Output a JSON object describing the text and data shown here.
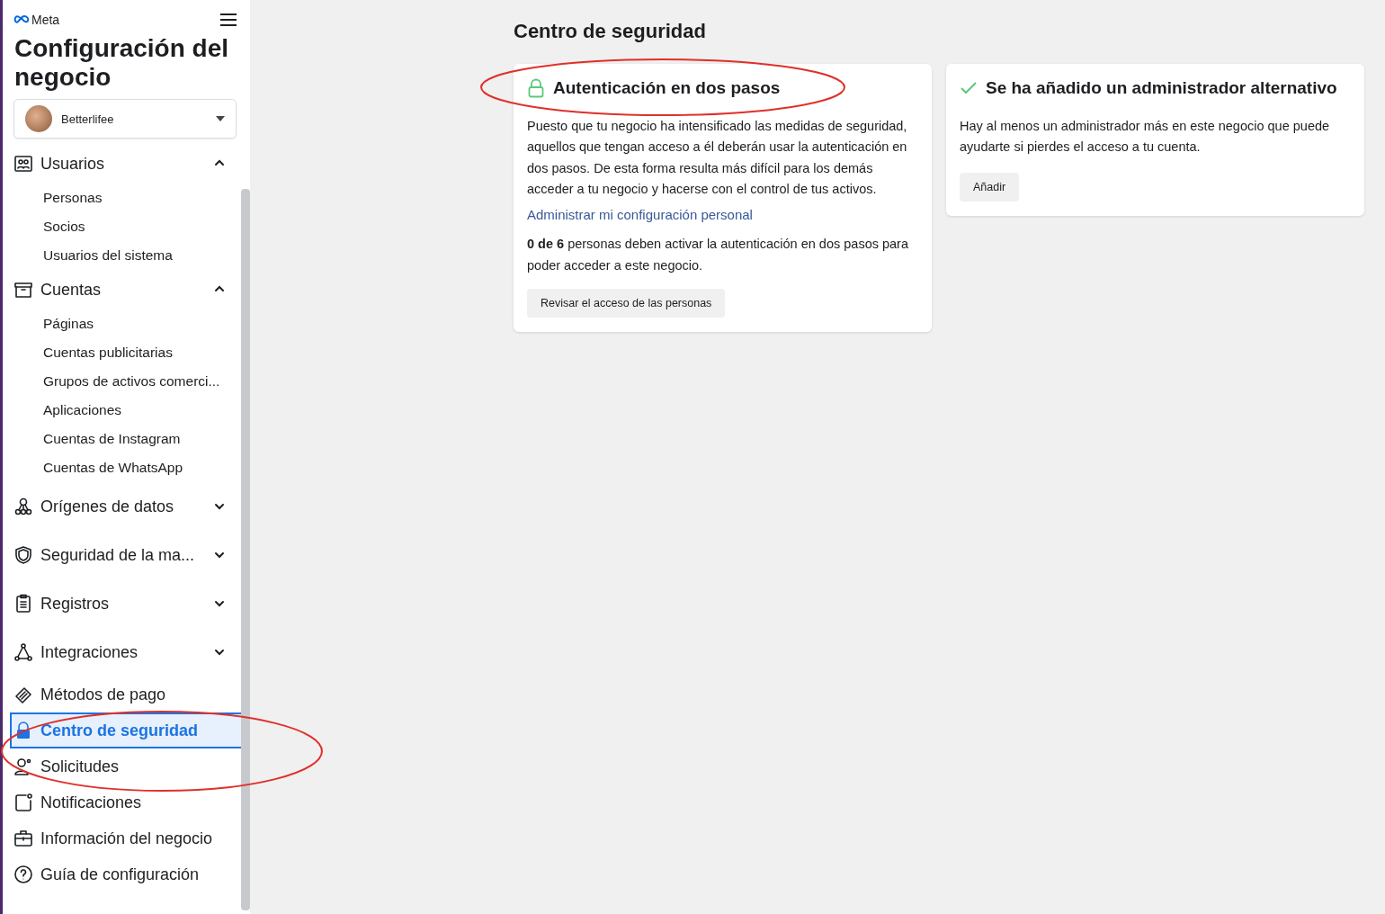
{
  "brand": "Meta",
  "title": "Configuración del negocio",
  "account": {
    "name": "Betterlifee"
  },
  "nav": [
    {
      "kind": "section",
      "label": "Usuarios",
      "expanded": true,
      "children": [
        {
          "label": "Personas",
          "selected": false
        },
        {
          "label": "Socios",
          "selected": false
        },
        {
          "label": "Usuarios del sistema",
          "selected": false
        }
      ]
    },
    {
      "kind": "section",
      "label": "Cuentas",
      "expanded": true,
      "children": [
        {
          "label": "Páginas",
          "selected": false
        },
        {
          "label": "Cuentas publicitarias",
          "selected": false
        },
        {
          "label": "Grupos de activos comerci...",
          "selected": false
        },
        {
          "label": "Aplicaciones",
          "selected": false
        },
        {
          "label": "Cuentas de Instagram",
          "selected": false
        },
        {
          "label": "Cuentas de WhatsApp",
          "selected": false
        }
      ]
    },
    {
      "kind": "section",
      "label": "Orígenes de datos",
      "expanded": false
    },
    {
      "kind": "section",
      "label": "Seguridad de la ma...",
      "expanded": false
    },
    {
      "kind": "section",
      "label": "Registros",
      "expanded": false
    },
    {
      "kind": "section",
      "label": "Integraciones",
      "expanded": false
    },
    {
      "kind": "item",
      "label": "Métodos de pago",
      "selected": false
    },
    {
      "kind": "item",
      "label": "Centro de seguridad",
      "selected": true
    },
    {
      "kind": "item",
      "label": "Solicitudes",
      "selected": false
    },
    {
      "kind": "item",
      "label": "Notificaciones",
      "selected": false
    },
    {
      "kind": "item",
      "label": "Información del negocio",
      "selected": false
    },
    {
      "kind": "item",
      "label": "Guía de configuración",
      "selected": false
    }
  ],
  "page_title": "Centro de seguridad",
  "cards": [
    {
      "kind": "lock",
      "title": "Autenticación en dos pasos",
      "body": "Puesto que tu negocio ha intensificado las medidas de seguridad, aquellos que tengan acceso a él deberán usar la autenticación en dos pasos. De esta forma resulta más difícil para los demás acceder a tu negocio y hacerse con el control de tus activos.",
      "link": "Administrar mi configuración personal",
      "note": "**0 de 6** personas deben activar la autenticación en dos pasos para poder acceder a este negocio.",
      "button": "Revisar el acceso de las personas"
    },
    {
      "kind": "check",
      "title": "Se ha añadido un administrador alternativo",
      "body": "Hay al menos un administrador más en este negocio que puede ayudarte si pierdes el acceso a tu cuenta.",
      "button": "Añadir"
    }
  ]
}
